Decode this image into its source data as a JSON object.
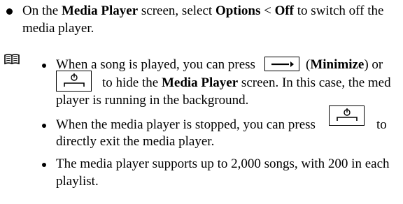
{
  "item1": {
    "pre": "On the ",
    "screen_name": "Media Player",
    "mid1": " screen, select ",
    "opt1": "Options",
    "sep": " < ",
    "opt2": "Off",
    "post": " to switch off the",
    "line2": "media player."
  },
  "note": {
    "icon": "book-icon",
    "b1": {
      "pre": "When a song is played, you can press",
      "paren_open": "(",
      "minimize": "Minimize",
      "paren_close": ") or",
      "line2_pre": "to hide the ",
      "screen_name": "Media Player",
      "line2_post": " screen. In this case, the med",
      "line3": "player is running in the background."
    },
    "b2": {
      "pre": "When the media player is stopped, you can press",
      "to": "to",
      "line2": "directly exit the media player."
    },
    "b3": {
      "line1": "The media player supports up to 2,000 songs, with 200 in each",
      "line2": "playlist."
    }
  }
}
